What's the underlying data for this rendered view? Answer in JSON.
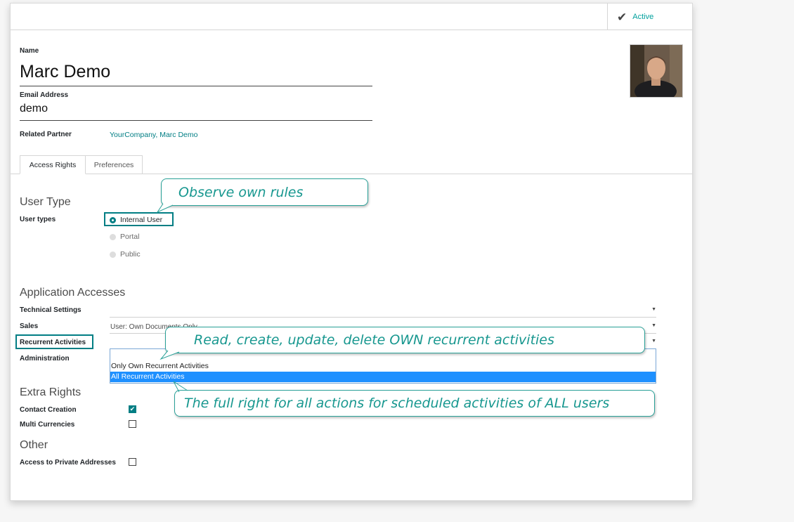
{
  "header": {
    "status_label": "Active",
    "status_icon": "check-icon"
  },
  "user": {
    "name_label": "Name",
    "name": "Marc Demo",
    "email_label": "Email Address",
    "email": "demo",
    "partner_label": "Related Partner",
    "partner": "YourCompany, Marc Demo"
  },
  "tabs": [
    "Access Rights",
    "Preferences"
  ],
  "user_type": {
    "title": "User Type",
    "label": "User types",
    "options": [
      {
        "label": "Internal User",
        "selected": true
      },
      {
        "label": "Portal",
        "selected": false
      },
      {
        "label": "Public",
        "selected": false
      }
    ]
  },
  "apps": {
    "title": "Application Accesses",
    "fields": [
      {
        "label": "Technical Settings",
        "value": ""
      },
      {
        "label": "Sales",
        "value": "User: Own Documents Only"
      },
      {
        "label": "Recurrent Activities",
        "value": ""
      },
      {
        "label": "Administration",
        "value": ""
      }
    ],
    "dropdown_options": [
      "Only Own Recurrent Activities",
      "All Recurrent Activities"
    ],
    "dropdown_highlighted": "All Recurrent Activities"
  },
  "extra": {
    "title": "Extra Rights",
    "items": [
      {
        "label": "Contact Creation",
        "checked": true
      },
      {
        "label": "Multi Currencies",
        "checked": false
      }
    ]
  },
  "other": {
    "title": "Other",
    "items": [
      {
        "label": "Access to Private Addresses",
        "checked": false
      }
    ]
  },
  "callouts": {
    "own_rules": "Observe own rules",
    "own_activities": "Read, create, update, delete OWN recurrent activities",
    "all_activities": "The full right for all actions for scheduled activities of ALL users"
  },
  "colors": {
    "accent": "#017e84",
    "callout_text": "#17978f",
    "selected_option": "#1e90ff"
  }
}
